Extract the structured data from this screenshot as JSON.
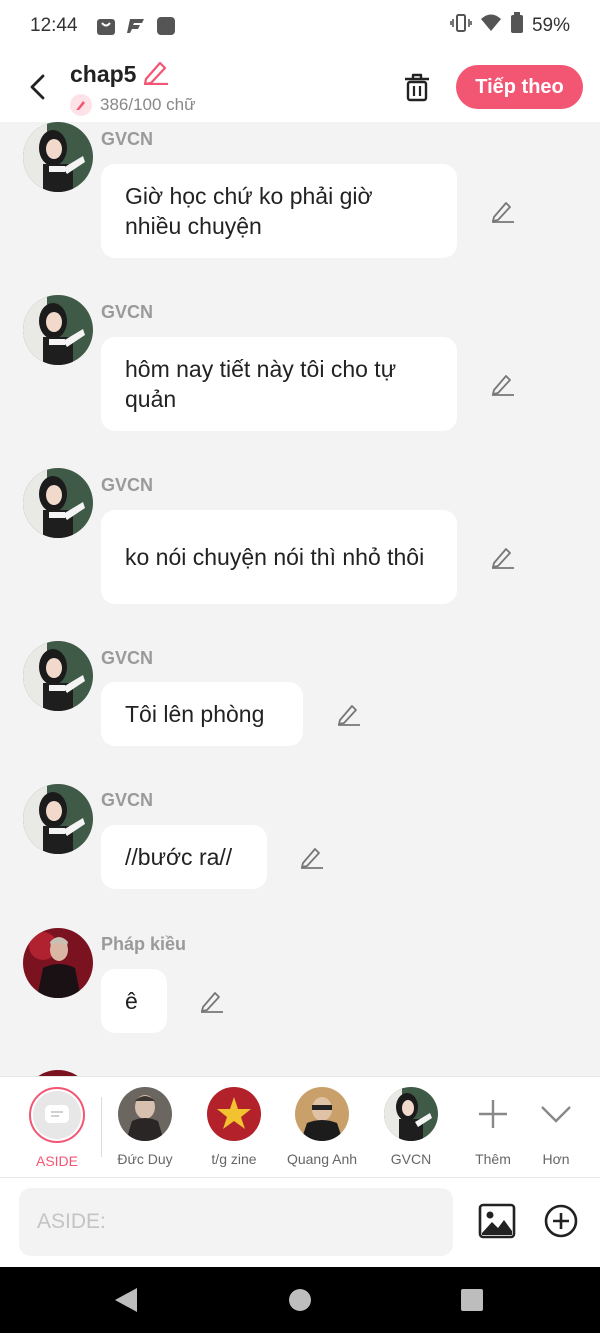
{
  "status_bar": {
    "time": "12:44",
    "battery": "59%"
  },
  "header": {
    "title": "chap5",
    "word_count": "386/100 chữ",
    "next_label": "Tiếp theo"
  },
  "messages": [
    {
      "sender": "GVCN",
      "text": "Giờ học chứ ko phải giờ nhiều chuyện",
      "avatar": "teacher-avatar"
    },
    {
      "sender": "GVCN",
      "text": "hôm nay tiết này tôi cho tự quản",
      "avatar": "teacher-avatar"
    },
    {
      "sender": "GVCN",
      "text": "ko nói chuyện nói thì nhỏ thôi",
      "avatar": "teacher-avatar"
    },
    {
      "sender": "GVCN",
      "text": "Tôi lên phòng",
      "avatar": "teacher-avatar"
    },
    {
      "sender": "GVCN",
      "text": "//bước ra//",
      "avatar": "teacher-avatar"
    },
    {
      "sender": "Pháp kiều",
      "text": "ê",
      "avatar": "phap-kieu-avatar"
    }
  ],
  "characters": [
    {
      "label": "ASIDE",
      "active": true
    },
    {
      "label": "Đức Duy"
    },
    {
      "label": "t/g zine"
    },
    {
      "label": "Quang Anh"
    },
    {
      "label": "GVCN"
    },
    {
      "label": "Thêm"
    },
    {
      "label": "Hơn"
    }
  ],
  "input": {
    "placeholder": "ASIDE:"
  },
  "colors": {
    "accent": "#f25673",
    "background": "#f3f3f3"
  }
}
